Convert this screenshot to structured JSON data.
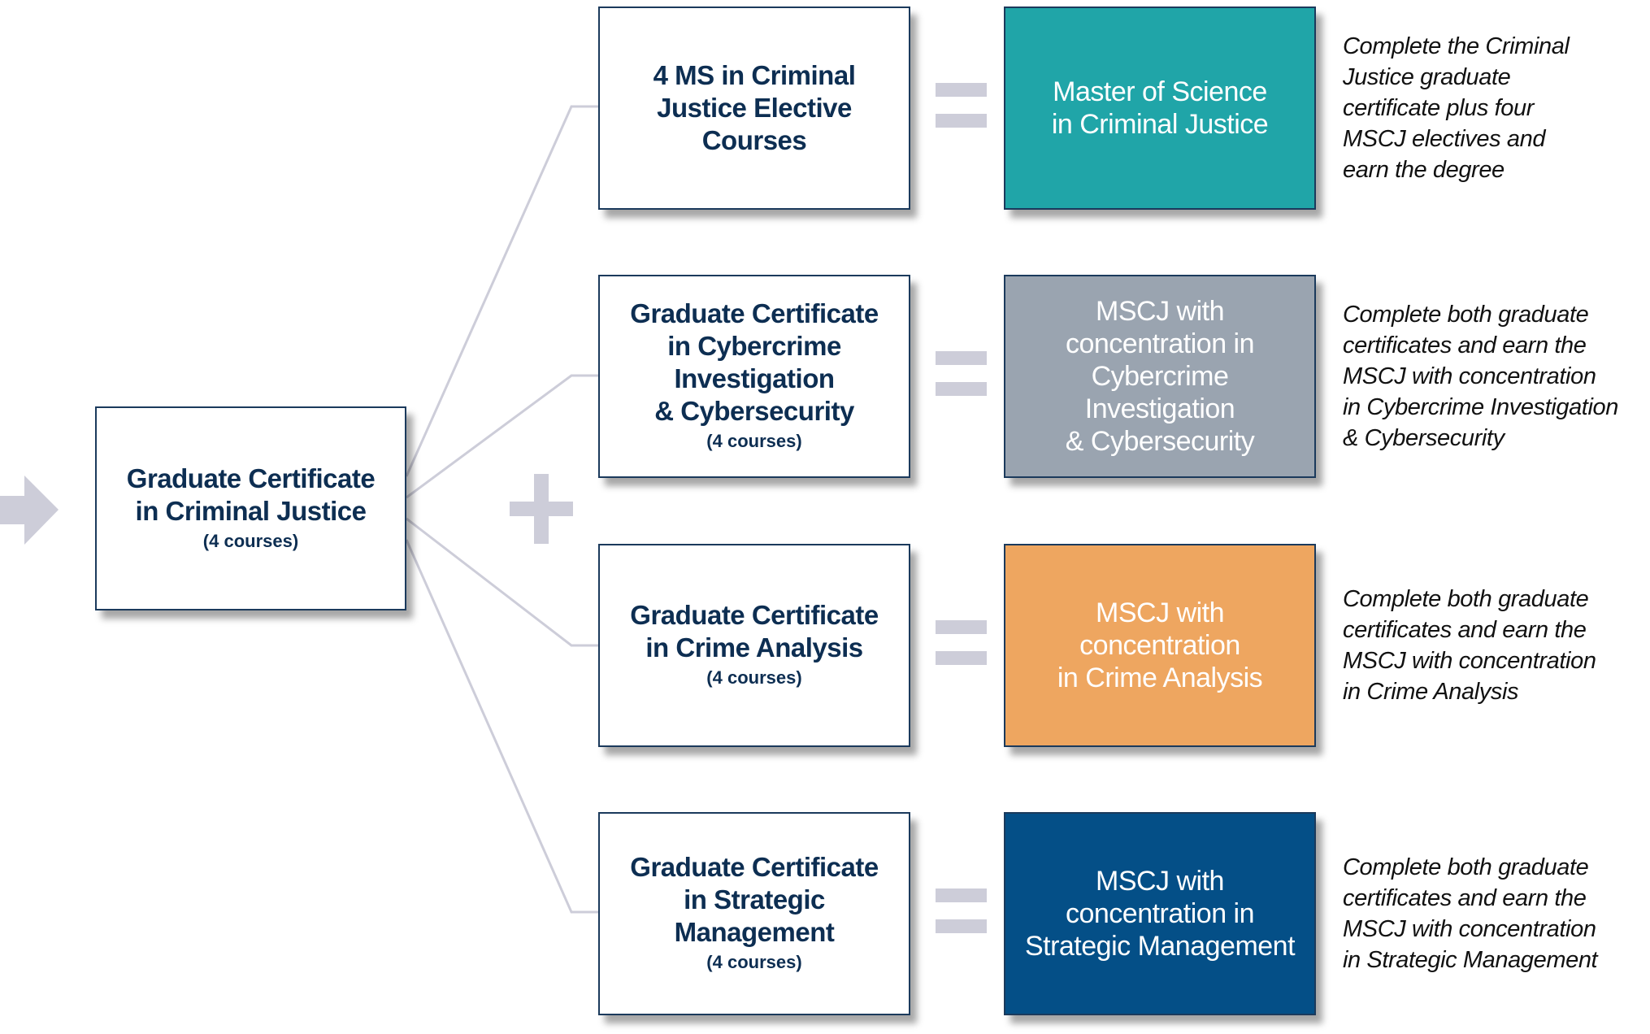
{
  "source": {
    "title": "Graduate Certificate\nin Criminal Justice",
    "sub": "(4 courses)"
  },
  "rows": [
    {
      "middle": {
        "title": "4 MS in Criminal\nJustice Elective\nCourses",
        "sub": ""
      },
      "result": {
        "title": "Master of Science\nin Criminal Justice",
        "color": "#20a5a8"
      },
      "desc": "Complete the Criminal\nJustice graduate\ncertificate plus four\nMSCJ electives and\nearn the degree"
    },
    {
      "middle": {
        "title": "Graduate Certificate\nin Cybercrime\nInvestigation\n& Cybersecurity",
        "sub": "(4 courses)"
      },
      "result": {
        "title": "MSCJ with\nconcentration in\nCybercrime\nInvestigation\n& Cybersecurity",
        "color": "#9aa4b0"
      },
      "desc": "Complete both graduate\ncertificates and earn the\nMSCJ with concentration\nin Cybercrime Investigation\n& Cybersecurity"
    },
    {
      "middle": {
        "title": "Graduate Certificate\nin Crime Analysis",
        "sub": "(4 courses)"
      },
      "result": {
        "title": "MSCJ with\nconcentration\nin Crime Analysis",
        "color": "#eea660"
      },
      "desc": "Complete both graduate\ncertificates and earn the\nMSCJ with concentration\nin Crime Analysis"
    },
    {
      "middle": {
        "title": "Graduate Certificate\nin Strategic\nManagement",
        "sub": "(4 courses)"
      },
      "result": {
        "title": "MSCJ with\nconcentration in\nStrategic Management",
        "color": "#044f87"
      },
      "desc": "Complete both graduate\ncertificates and earn the\nMSCJ with concentration\nin Strategic Management"
    }
  ],
  "colors": {
    "text": "#0d2e52",
    "connector": "#cdcdd9",
    "border": "#1b3a5c"
  }
}
